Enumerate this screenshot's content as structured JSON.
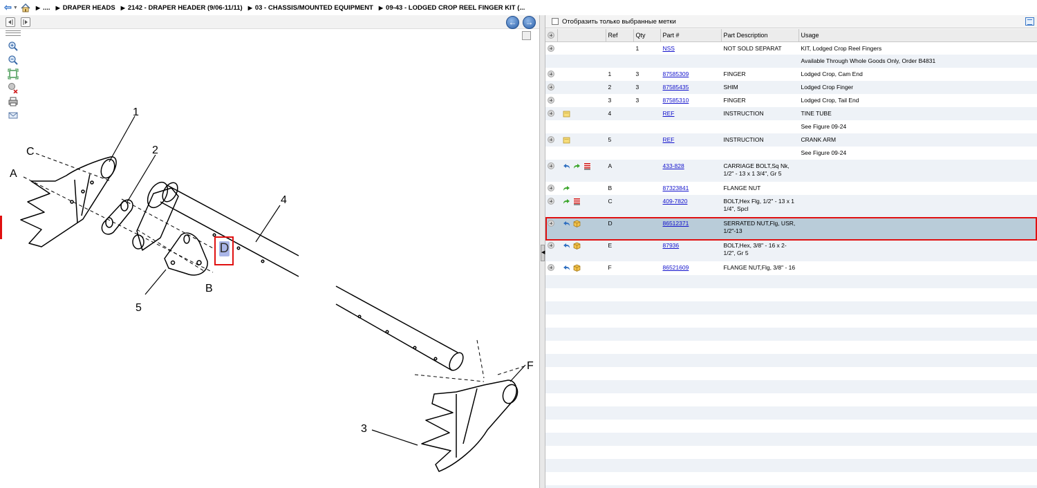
{
  "breadcrumb": {
    "ellipsis": "....",
    "items": [
      "DRAPER HEADS",
      "2142 - DRAPER HEADER (9/06-11/11)",
      "03 - CHASSIS/MOUNTED EQUIPMENT",
      "09-43 - LODGED CROP REEL FINGER KIT (..."
    ]
  },
  "diagram": {
    "callouts": [
      "1",
      "2",
      "3",
      "4",
      "5",
      "A",
      "B",
      "C",
      "F"
    ],
    "hotspot": "D"
  },
  "filter": {
    "label": "Отобразить только выбранные метки"
  },
  "table": {
    "headers": [
      "",
      "",
      "Ref",
      "Qty",
      "Part #",
      "Part Description",
      "Usage"
    ],
    "rows": [
      {
        "icons": [],
        "ref": "",
        "qty": "1",
        "part": "NSS",
        "desc": "NOT SOLD SEPARAT",
        "usage": "KIT, Lodged Crop Reel Fingers"
      },
      {
        "icons": [],
        "ref": "",
        "qty": "",
        "part": "",
        "desc": "",
        "usage": "Available Through Whole Goods Only, Order B4831",
        "noplus": true
      },
      {
        "icons": [],
        "ref": "1",
        "qty": "3",
        "part": "87585309",
        "desc": "FINGER",
        "usage": "Lodged Crop, Cam End"
      },
      {
        "icons": [],
        "ref": "2",
        "qty": "3",
        "part": "87585435",
        "desc": "SHIM",
        "usage": "Lodged Crop Finger"
      },
      {
        "icons": [],
        "ref": "3",
        "qty": "3",
        "part": "87585310",
        "desc": "FINGER",
        "usage": "Lodged Crop, Tail End"
      },
      {
        "icons": [
          "note-icon"
        ],
        "ref": "4",
        "qty": "",
        "part": "REF",
        "desc": "INSTRUCTION",
        "usage": "TINE TUBE"
      },
      {
        "icons": [],
        "ref": "",
        "qty": "",
        "part": "",
        "desc": "",
        "usage": "See Figure 09-24",
        "noplus": true
      },
      {
        "icons": [
          "note-icon"
        ],
        "ref": "5",
        "qty": "",
        "part": "REF",
        "desc": "INSTRUCTION",
        "usage": "CRANK ARM"
      },
      {
        "icons": [],
        "ref": "",
        "qty": "",
        "part": "",
        "desc": "",
        "usage": "See Figure 09-24",
        "noplus": true
      },
      {
        "icons": [
          "reply-icon",
          "forward-icon",
          "list-icon"
        ],
        "ref": "A",
        "qty": "",
        "part": "433-828",
        "desc": "CARRIAGE BOLT,Sq Nk, 1/2\" - 13 x 1 3/4\", Gr 5",
        "usage": "",
        "tall": true
      },
      {
        "icons": [
          "forward-icon"
        ],
        "ref": "B",
        "qty": "",
        "part": "87323841",
        "desc": "FLANGE NUT",
        "usage": ""
      },
      {
        "icons": [
          "forward-icon",
          "list-icon"
        ],
        "ref": "C",
        "qty": "",
        "part": "409-7820",
        "desc": "BOLT,Hex Flg, 1/2\" - 13 x 1 1/4\", Spcl",
        "usage": "",
        "tall": true
      },
      {
        "icons": [
          "reply-icon",
          "box-icon"
        ],
        "ref": "D",
        "qty": "",
        "part": "86512371",
        "desc": "SERRATED NUT,Flg, USR, 1/2\"-13",
        "usage": "",
        "tall": true,
        "selected": true
      },
      {
        "icons": [
          "reply-icon",
          "box-icon"
        ],
        "ref": "E",
        "qty": "",
        "part": "87936",
        "desc": "BOLT,Hex, 3/8\" - 16 x 2-1/2\", Gr 5",
        "usage": "",
        "tall": true
      },
      {
        "icons": [
          "reply-icon",
          "box-icon"
        ],
        "ref": "F",
        "qty": "",
        "part": "86521609",
        "desc": "FLANGE NUT,Flg, 3/8\" - 16",
        "usage": ""
      }
    ]
  }
}
